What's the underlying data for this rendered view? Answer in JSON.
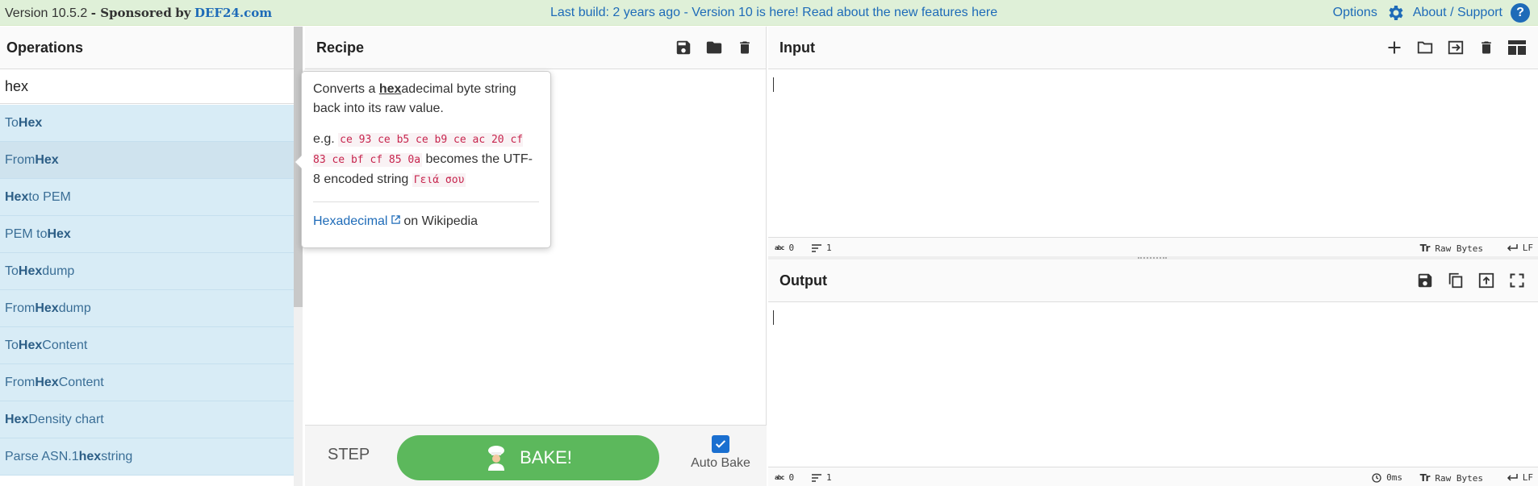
{
  "banner": {
    "version": "Version 10.5.2",
    "sponsored_prefix": "- Sponsored",
    "sponsored_by": "by",
    "sponsor_name": "DEF24.com",
    "build_text": "Last build: 2 years ago - Version 10 is here! Read about the new features",
    "build_link": "here",
    "options_label": "Options",
    "about_label": "About / Support"
  },
  "operations": {
    "title": "Operations",
    "search_value": "hex",
    "items": [
      {
        "pre": "To ",
        "match": "Hex",
        "post": ""
      },
      {
        "pre": "From ",
        "match": "Hex",
        "post": ""
      },
      {
        "pre": "",
        "match": "Hex",
        "post": " to PEM"
      },
      {
        "pre": "PEM to ",
        "match": "Hex",
        "post": ""
      },
      {
        "pre": "To ",
        "match": "Hex",
        "post": "dump"
      },
      {
        "pre": "From ",
        "match": "Hex",
        "post": "dump"
      },
      {
        "pre": "To ",
        "match": "Hex",
        "post": " Content"
      },
      {
        "pre": "From ",
        "match": "Hex",
        "post": " Content"
      },
      {
        "pre": "",
        "match": "Hex",
        "post": " Density chart"
      },
      {
        "pre": "Parse ASN.1 ",
        "match": "hex",
        "post": " string"
      }
    ]
  },
  "recipe": {
    "title": "Recipe",
    "step_label": "STEP",
    "bake_label": "BAKE!",
    "auto_bake_label": "Auto Bake"
  },
  "popover": {
    "intro_pre": "Converts a ",
    "intro_match": "hex",
    "intro_post": "adecimal byte string back into its raw value.",
    "eg_label": "e.g.",
    "eg_code": "ce 93 ce b5 ce b9 ce ac 20 cf 83 ce bf cf 85 0a",
    "becomes": "becomes the UTF-8 encoded string",
    "result_code": "Γειά σου",
    "link_label": "Hexadecimal",
    "link_suffix": "on Wikipedia"
  },
  "input": {
    "title": "Input",
    "chars": "0",
    "lines": "1",
    "encoding": "Raw Bytes",
    "eol": "LF"
  },
  "output": {
    "title": "Output",
    "chars": "0",
    "lines": "1",
    "time": "0ms",
    "encoding": "Raw Bytes",
    "eol": "LF"
  },
  "colors": {
    "bake_green": "#5cb85c",
    "link_blue": "#1e6bb8",
    "op_bg": "#d8ecf6"
  }
}
